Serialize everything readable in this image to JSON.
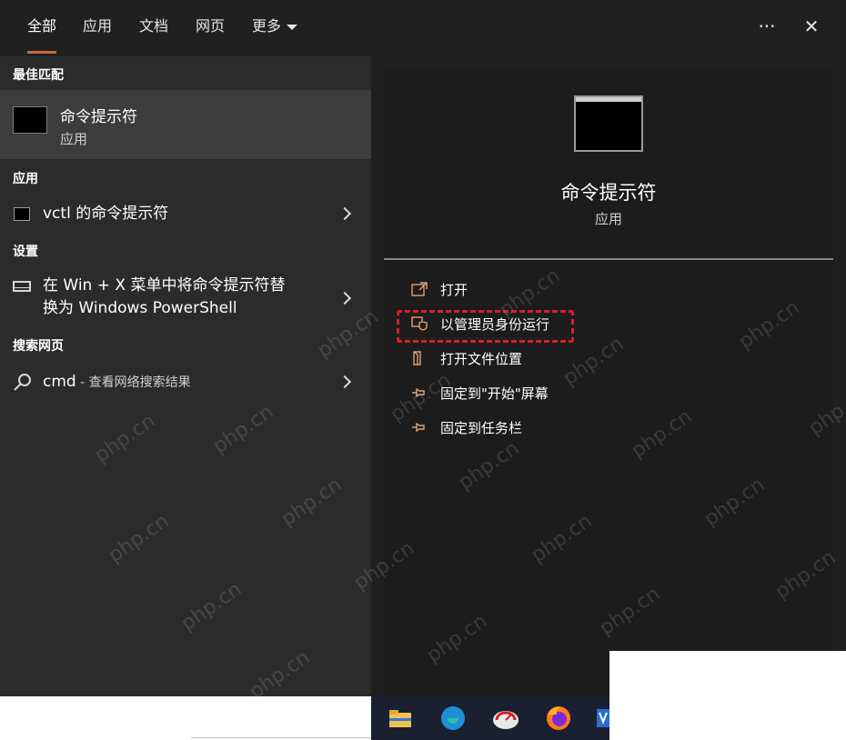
{
  "tabs": [
    {
      "label": "全部",
      "active": true
    },
    {
      "label": "应用",
      "active": false
    },
    {
      "label": "文档",
      "active": false
    },
    {
      "label": "网页",
      "active": false
    },
    {
      "label": "更多",
      "active": false
    }
  ],
  "top_icons": {
    "more": "···",
    "close": "✕"
  },
  "left": {
    "best_match": {
      "heading": "最佳匹配",
      "title": "命令提示符",
      "subtitle": "应用"
    },
    "apps": {
      "heading": "应用",
      "items": [
        {
          "label": "vctl 的命令提示符"
        }
      ]
    },
    "settings": {
      "heading": "设置",
      "items": [
        {
          "line1": "在 Win + X 菜单中将命令提示符替",
          "line2": "换为 Windows PowerShell"
        }
      ]
    },
    "web": {
      "heading": "搜索网页",
      "items": [
        {
          "query": "cmd",
          "suffix": " - 查看网络搜索结果"
        }
      ]
    }
  },
  "right": {
    "title": "命令提示符",
    "subtitle": "应用",
    "actions": [
      {
        "label": "打开",
        "icon": "open-icon"
      },
      {
        "label": "以管理员身份运行",
        "icon": "shield-icon"
      },
      {
        "label": "打开文件位置",
        "icon": "folder-icon"
      },
      {
        "label": "固定到\"开始\"屏幕",
        "icon": "pin-icon"
      },
      {
        "label": "固定到任务栏",
        "icon": "pin-icon"
      }
    ]
  },
  "watermark": "php.cn",
  "colors": {
    "accent": "#c86a3a",
    "highlight": "#d3212a",
    "action_icon": "#e0a070"
  }
}
